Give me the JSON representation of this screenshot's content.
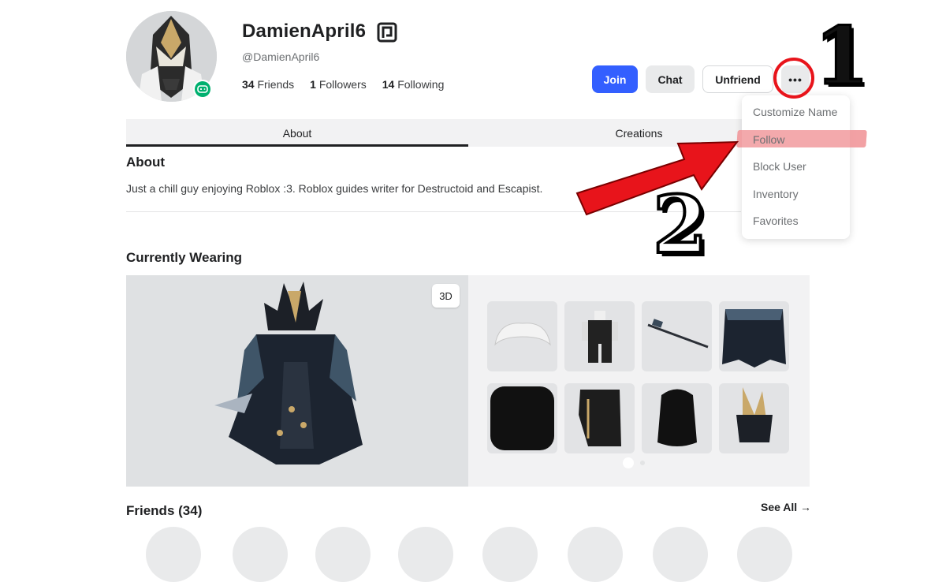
{
  "profile": {
    "display_name": "DamienApril6",
    "handle": "@DamienApril6",
    "friends_count": "34",
    "friends_label": "Friends",
    "followers_count": "1",
    "followers_label": "Followers",
    "following_count": "14",
    "following_label": "Following"
  },
  "actions": {
    "join": "Join",
    "chat": "Chat",
    "unfriend": "Unfriend",
    "more": "•••"
  },
  "menu": {
    "items": [
      "Customize Name",
      "Follow",
      "Block User",
      "Inventory",
      "Favorites"
    ]
  },
  "tabs": [
    "About",
    "Creations"
  ],
  "about": {
    "title": "About",
    "text": "Just a chill guy enjoying Roblox :3. Roblox guides writer for Destructoid and Escapist."
  },
  "currently_wearing": {
    "title": "Currently Wearing",
    "view_3d": "3D"
  },
  "friends": {
    "title": "Friends (34)",
    "see_all": "See All →"
  },
  "annotations": {
    "step1": "1",
    "step2": "2",
    "accent": "#e8141b"
  },
  "colors": {
    "primary_button": "#335fff",
    "presence": "#00b06f",
    "highlight": "#f2a0a3"
  }
}
